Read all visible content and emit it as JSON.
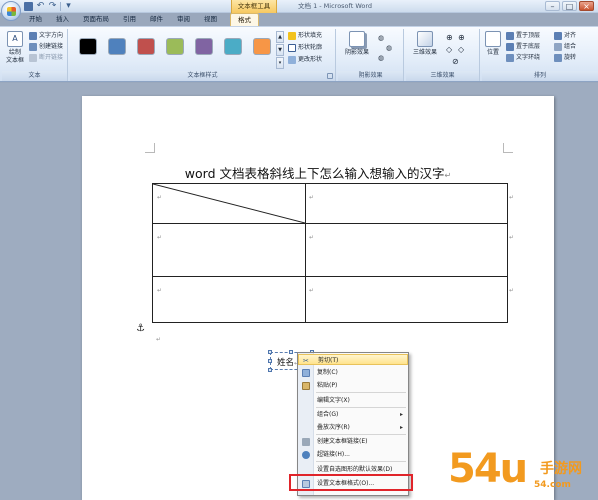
{
  "window": {
    "title": "文档 1 - Microsoft Word",
    "context_tab_header": "文本框工具"
  },
  "quick_access": {
    "save_icon": "save-icon",
    "undo_icon": "undo-icon",
    "redo_icon": "redo-icon"
  },
  "ribbon_tabs": [
    {
      "label": "开始",
      "active": false
    },
    {
      "label": "插入",
      "active": false
    },
    {
      "label": "页面布局",
      "active": false
    },
    {
      "label": "引用",
      "active": false
    },
    {
      "label": "邮件",
      "active": false
    },
    {
      "label": "审阅",
      "active": false
    },
    {
      "label": "视图",
      "active": false
    },
    {
      "label": "格式",
      "active": true
    }
  ],
  "ribbon": {
    "text_group": {
      "label": "文本",
      "draw_textbox": "绘制\n文本框",
      "text_direction": "文字方向",
      "create_link": "创建链接",
      "break_link": "断开链接"
    },
    "textbox_styles_group": {
      "label": "文本框样式",
      "swatches": [
        "#000000",
        "#4f81bd",
        "#c0504d",
        "#9bbb59",
        "#8064a2",
        "#4bacc6",
        "#f79646"
      ],
      "shape_fill": "形状填充",
      "shape_outline": "形状轮廓",
      "change_shape": "更改形状"
    },
    "shadow_group": {
      "label": "阴影效果",
      "shadow_btn": "阴影效果"
    },
    "threed_group": {
      "label": "三维效果",
      "threed_btn": "三维效果"
    },
    "arrange_group": {
      "label": "排列",
      "position": "位置",
      "bring_front": "置于顶层",
      "send_back": "置于底层",
      "text_wrap": "文字环绕",
      "align": "对齐",
      "group": "组合",
      "rotate": "旋转"
    }
  },
  "document": {
    "heading": "word 文档表格斜线上下怎么输入想输入的汉字",
    "para_mark": "↵",
    "textbox_text": "姓名"
  },
  "context_menu": {
    "items": [
      {
        "label": "剪切(T)",
        "icon": "cut-icon",
        "submenu": false,
        "highlighted": true
      },
      {
        "label": "复制(C)",
        "icon": "copy-icon",
        "submenu": false,
        "highlighted": false
      },
      {
        "label": "粘贴(P)",
        "icon": "paste-icon",
        "submenu": false,
        "highlighted": false
      },
      {
        "label": "编辑文字(X)",
        "icon": "",
        "submenu": false,
        "highlighted": false
      },
      {
        "label": "组合(G)",
        "icon": "",
        "submenu": true,
        "highlighted": false
      },
      {
        "label": "叠放次序(R)",
        "icon": "",
        "submenu": true,
        "highlighted": false
      },
      {
        "label": "创建文本框链接(E)",
        "icon": "link-icon",
        "submenu": false,
        "highlighted": false
      },
      {
        "label": "超链接(H)...",
        "icon": "hyperlink-icon",
        "submenu": false,
        "highlighted": false
      },
      {
        "label": "设置自选图形的默认效果(D)",
        "icon": "",
        "submenu": false,
        "highlighted": false
      },
      {
        "label": "设置文本框格式(O)...",
        "icon": "format-textbox-icon",
        "submenu": false,
        "highlighted": false
      }
    ]
  },
  "watermark": {
    "brand_number": "54",
    "brand_suffix": "u",
    "brand_cn": "手游网",
    "url": "54.com"
  }
}
